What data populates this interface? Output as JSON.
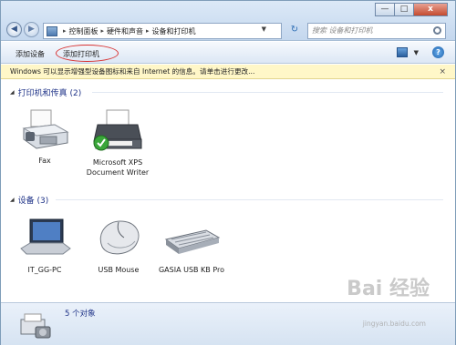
{
  "window": {
    "controls": {
      "minimize": "—",
      "maximize": "□",
      "close": "x"
    }
  },
  "address": {
    "crumbs": [
      "控制面板",
      "硬件和声音",
      "设备和打印机"
    ]
  },
  "search": {
    "placeholder": "搜索 设备和打印机"
  },
  "toolbar": {
    "add_device": "添加设备",
    "add_printer": "添加打印机"
  },
  "infobar": {
    "text": "Windows 可以显示增强型设备图标和来自 Internet 的信息。请单击进行更改..."
  },
  "groups": {
    "printers": {
      "title": "打印机和传真 (2)",
      "items": [
        {
          "label": "Fax",
          "icon": "fax-icon"
        },
        {
          "label": "Microsoft XPS Document Writer",
          "icon": "printer-icon"
        }
      ]
    },
    "devices": {
      "title": "设备 (3)",
      "items": [
        {
          "label": "IT_GG-PC",
          "icon": "laptop-icon"
        },
        {
          "label": "USB Mouse",
          "icon": "mouse-icon"
        },
        {
          "label": "GASIA USB KB Pro",
          "icon": "keyboard-icon"
        }
      ]
    }
  },
  "status": {
    "count_text": "5 个对象"
  },
  "watermark": {
    "text": "Bai 经验",
    "sub": "jingyan.baidu.com"
  }
}
